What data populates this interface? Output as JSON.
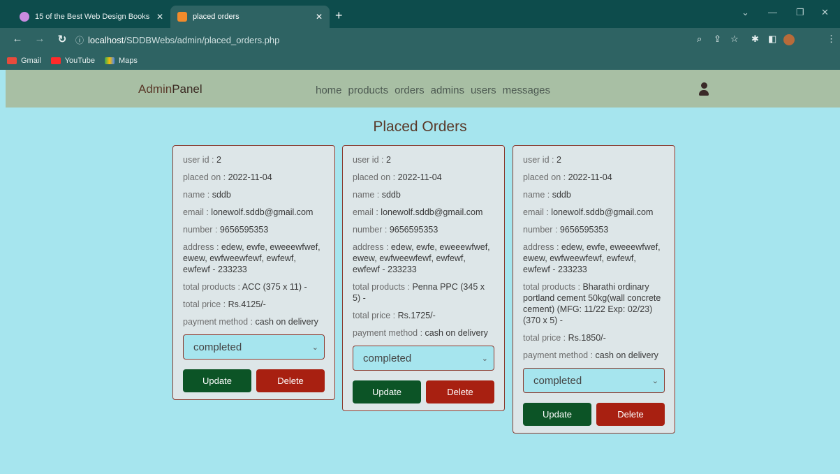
{
  "browser": {
    "tabs": [
      {
        "label": "15 of the Best Web Design Books",
        "active": false
      },
      {
        "label": "placed orders",
        "active": true
      }
    ],
    "url_host": "localhost",
    "url_path": "/SDDBWebs/admin/placed_orders.php",
    "bookmarks": [
      "Gmail",
      "YouTube",
      "Maps"
    ]
  },
  "header": {
    "logo_prefix": "Admin",
    "logo_suffix": "Panel",
    "nav": [
      "home",
      "products",
      "orders",
      "admins",
      "users",
      "messages"
    ]
  },
  "page": {
    "title": "Placed Orders"
  },
  "labels": {
    "user_id": "user id : ",
    "placed_on": "placed on : ",
    "name": "name : ",
    "email": "email : ",
    "number": "number : ",
    "address": "address : ",
    "total_products": "total products : ",
    "total_price": "total price : ",
    "payment_method": "payment method : ",
    "update": "Update",
    "delete": "Delete"
  },
  "orders": [
    {
      "user_id": "2",
      "placed_on": "2022-11-04",
      "name": "sddb",
      "email": "lonewolf.sddb@gmail.com",
      "number": "9656595353",
      "address": "edew, ewfe, eweeewfwef, ewew, ewfweewfewf, ewfewf, ewfewf - 233233",
      "total_products": "ACC (375 x 11) -",
      "total_price": "Rs.4125/-",
      "payment_method": "cash on delivery",
      "status": "completed"
    },
    {
      "user_id": "2",
      "placed_on": "2022-11-04",
      "name": "sddb",
      "email": "lonewolf.sddb@gmail.com",
      "number": "9656595353",
      "address": "edew, ewfe, eweeewfwef, ewew, ewfweewfewf, ewfewf, ewfewf - 233233",
      "total_products": "Penna PPC (345 x 5) -",
      "total_price": "Rs.1725/-",
      "payment_method": "cash on delivery",
      "status": "completed"
    },
    {
      "user_id": "2",
      "placed_on": "2022-11-04",
      "name": "sddb",
      "email": "lonewolf.sddb@gmail.com",
      "number": "9656595353",
      "address": "edew, ewfe, eweeewfwef, ewew, ewfweewfewf, ewfewf, ewfewf - 233233",
      "total_products": "Bharathi ordinary portland cement 50kg(wall concrete cement) (MFG: 11/22 Exp: 02/23) (370 x 5) -",
      "total_price": "Rs.1850/-",
      "payment_method": "cash on delivery",
      "status": "completed"
    }
  ]
}
